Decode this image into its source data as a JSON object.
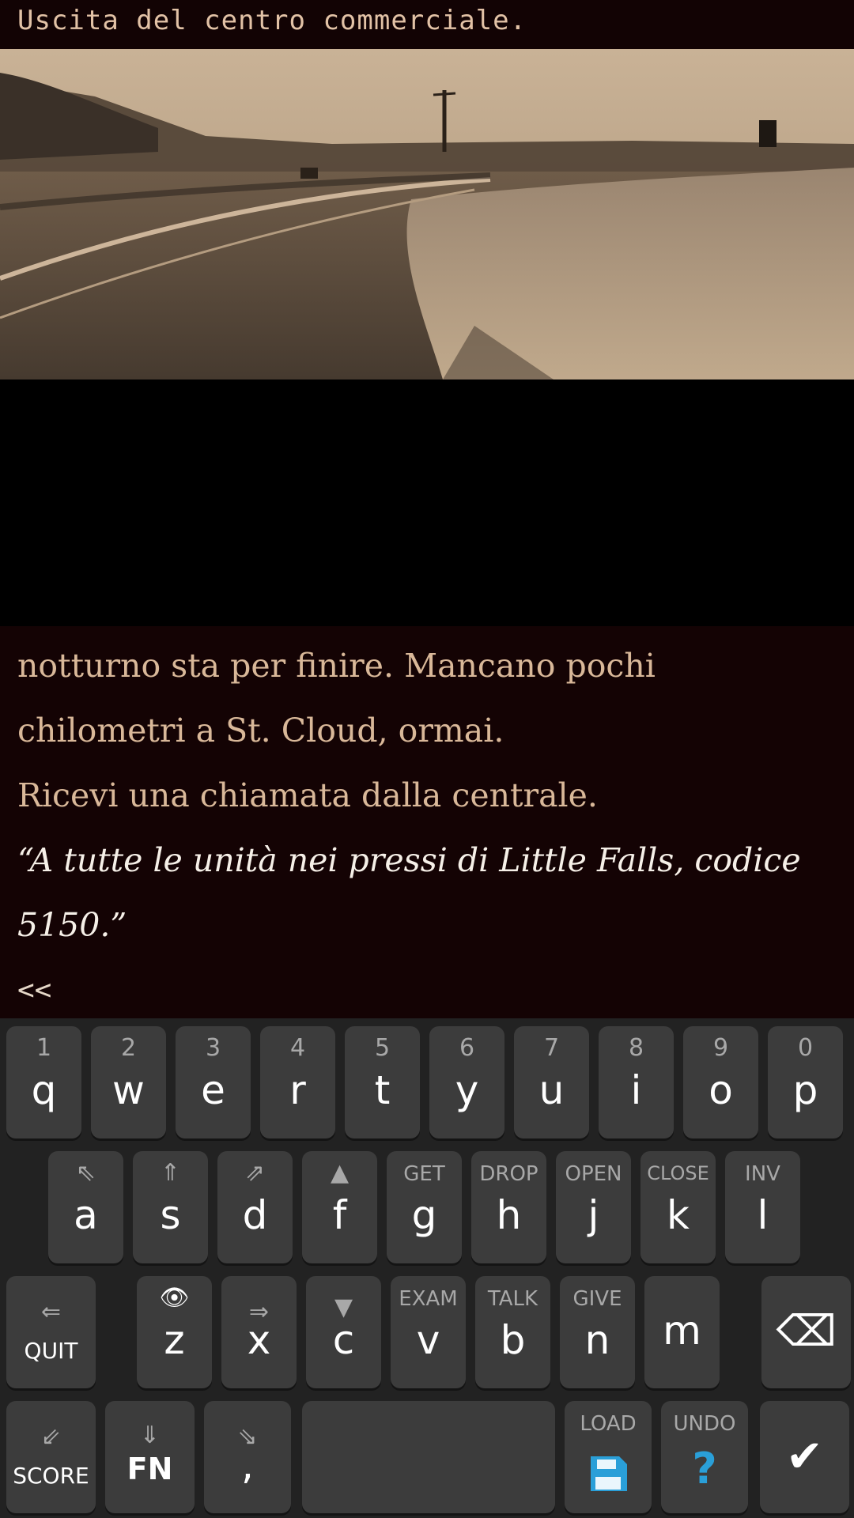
{
  "header": {
    "title": "Uscita del centro commerciale."
  },
  "story": {
    "line1": "notturno sta per finire. Mancano pochi",
    "line2": "chilometri a St. Cloud, ormai.",
    "line3": "Ricevi una chiamata dalla centrale.",
    "quote1": "“A tutte le unità nei pressi di Little Falls, codice",
    "quote2": "5150.”",
    "back": "<<"
  },
  "keyboard": {
    "row1": [
      {
        "hint": "1",
        "key": "q"
      },
      {
        "hint": "2",
        "key": "w"
      },
      {
        "hint": "3",
        "key": "e"
      },
      {
        "hint": "4",
        "key": "r"
      },
      {
        "hint": "5",
        "key": "t"
      },
      {
        "hint": "6",
        "key": "y"
      },
      {
        "hint": "7",
        "key": "u"
      },
      {
        "hint": "8",
        "key": "i"
      },
      {
        "hint": "9",
        "key": "o"
      },
      {
        "hint": "0",
        "key": "p"
      }
    ],
    "row2": [
      {
        "hint": "⇖",
        "key": "a"
      },
      {
        "hint": "⇑",
        "key": "s"
      },
      {
        "hint": "⇗",
        "key": "d"
      },
      {
        "hint": "▲",
        "key": "f"
      },
      {
        "hint": "GET",
        "key": "g"
      },
      {
        "hint": "DROP",
        "key": "h"
      },
      {
        "hint": "OPEN",
        "key": "j"
      },
      {
        "hint": "CLOSE",
        "key": "k"
      },
      {
        "hint": "INV",
        "key": "l"
      }
    ],
    "row3": {
      "quit_arrow": "⇐",
      "quit": "QUIT",
      "z_hint": "👁",
      "z": "z",
      "x_hint": "⇒",
      "x": "x",
      "c_hint": "▼",
      "c": "c",
      "v_hint": "EXAM",
      "v": "v",
      "b_hint": "TALK",
      "b": "b",
      "n_hint": "GIVE",
      "n": "n",
      "m": "m",
      "backspace": "⌫"
    },
    "row4": {
      "score_arrow": "⇙",
      "score": "SCORE",
      "fn_arrow": "⇓",
      "fn": "FN",
      "comma_arrow": "⇘",
      "comma": ",",
      "space": "",
      "load": "LOAD",
      "undo": "UNDO",
      "undo_symbol": "?",
      "enter": "✔"
    },
    "colors": {
      "key_bg": "#3c3c3c",
      "accent_blue": "#2a9fd8"
    }
  }
}
